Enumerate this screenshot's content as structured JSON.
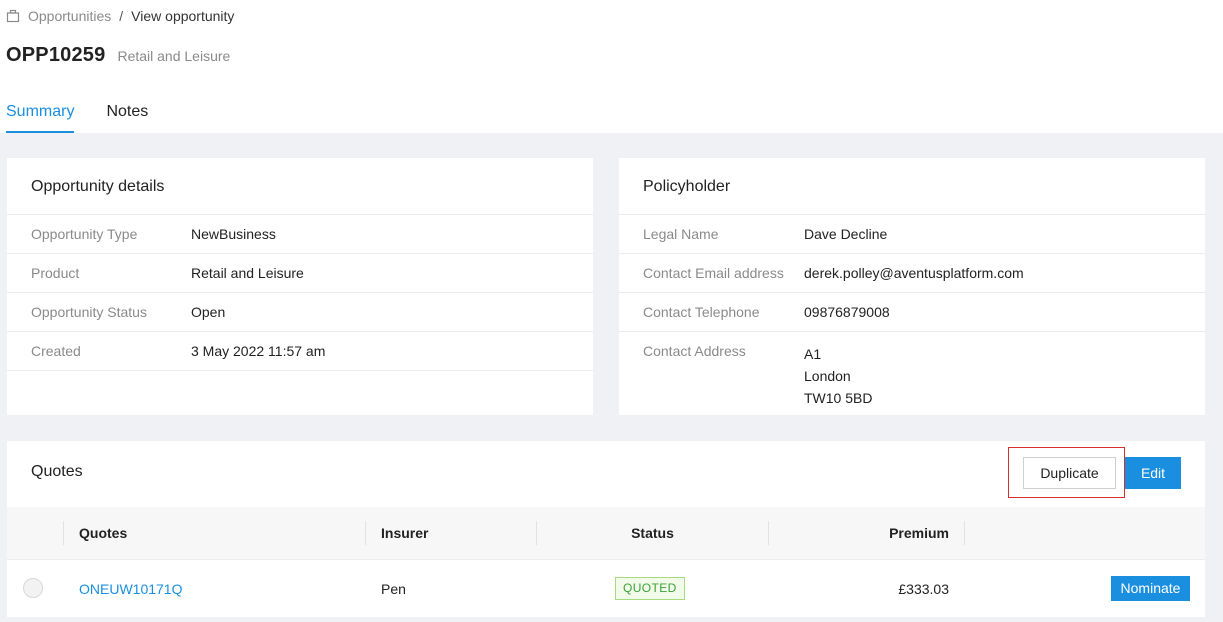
{
  "breadcrumb": {
    "icon": "briefcase-icon",
    "parent": "Opportunities",
    "separator": "/",
    "current": "View opportunity"
  },
  "header": {
    "title": "OPP10259",
    "subtitle": "Retail and Leisure"
  },
  "tabs": [
    {
      "label": "Summary",
      "active": true
    },
    {
      "label": "Notes",
      "active": false
    }
  ],
  "opportunity_details": {
    "title": "Opportunity details",
    "rows": [
      {
        "label": "Opportunity Type",
        "value": "NewBusiness"
      },
      {
        "label": "Product",
        "value": "Retail and Leisure"
      },
      {
        "label": "Opportunity Status",
        "value": "Open"
      },
      {
        "label": "Created",
        "value": "3 May 2022 11:57 am"
      }
    ]
  },
  "policyholder": {
    "title": "Policyholder",
    "rows": [
      {
        "label": "Legal Name",
        "value": "Dave Decline"
      },
      {
        "label": "Contact Email address",
        "value": "derek.polley@aventusplatform.com"
      },
      {
        "label": "Contact Telephone",
        "value": "09876879008"
      }
    ],
    "address": {
      "label": "Contact Address",
      "lines": [
        "A1",
        "London",
        "TW10 5BD"
      ]
    }
  },
  "quotes": {
    "title": "Quotes",
    "duplicate_label": "Duplicate",
    "edit_label": "Edit",
    "columns": [
      "Quotes",
      "Insurer",
      "Status",
      "Premium"
    ],
    "rows": [
      {
        "quote": "ONEUW10171Q",
        "insurer": "Pen",
        "status": "QUOTED",
        "premium": "£333.03",
        "action": "Nominate"
      }
    ]
  },
  "colors": {
    "accent": "#1a8fe0",
    "highlight_border": "#d32f2f",
    "status_green": "#3aa13a"
  }
}
